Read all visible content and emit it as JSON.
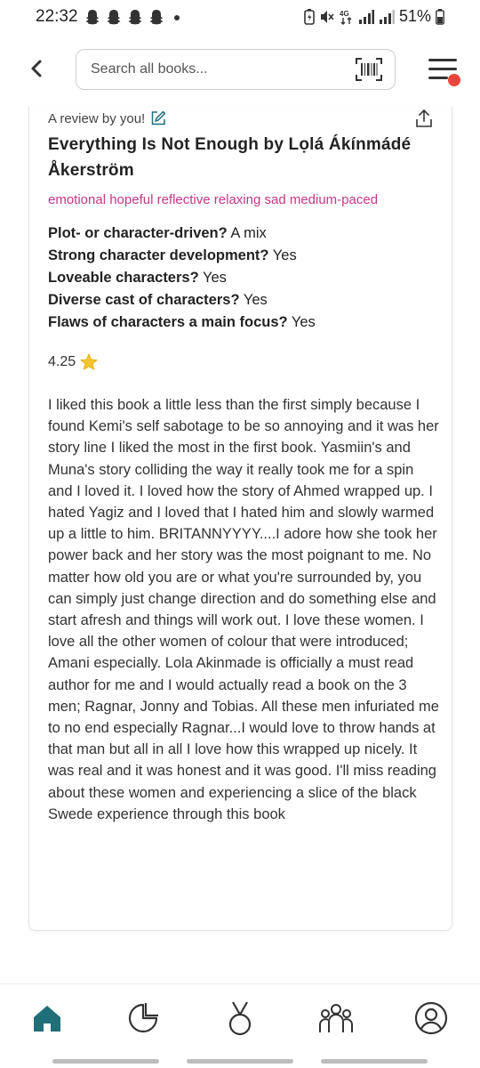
{
  "status_bar": {
    "time": "22:32",
    "battery_percent": "51%",
    "signal_label": "4G",
    "notification_icons": [
      "snapchat-icon",
      "snapchat-icon",
      "snapchat-icon",
      "snapchat-icon"
    ]
  },
  "header": {
    "search_placeholder": "Search all books...",
    "menu_has_notification": true
  },
  "review": {
    "byline": "A review by you!",
    "title": "Everything Is Not Enough by Lọlá Ákínmádé Åkerström",
    "moods": "emotional hopeful reflective relaxing sad medium-paced",
    "qa": [
      {
        "q": "Plot- or character-driven?",
        "a": "A mix"
      },
      {
        "q": "Strong character development?",
        "a": "Yes"
      },
      {
        "q": "Loveable characters?",
        "a": "Yes"
      },
      {
        "q": "Diverse cast of characters?",
        "a": "Yes"
      },
      {
        "q": "Flaws of characters a main focus?",
        "a": "Yes"
      }
    ],
    "rating": "4.25",
    "text": "I liked this book a little less than the first simply because I found Kemi's self sabotage to be so annoying and it was her story line I liked the most in the first book. Yasmiin's and Muna's story colliding the way it really took me for a spin and I loved it. I loved how the story of Ahmed wrapped up. I hated Yagiz and I loved that I hated him and slowly warmed up a little to him. BRITANNYYYY....I adore how she took her power back and her story was the most poignant to me. No matter how old you are or what you're surrounded by, you can simply just change direction and do something else and start afresh and things will work out. I love these women. I love all the other women of colour that were introduced; Amani especially. Lola Akinmade is officially a must read author for me and I would actually read a book on the 3 men; Ragnar, Jonny and Tobias. All these men infuriated me to no end especially Ragnar...I would love to throw hands at that man but all in all I love how this wrapped up nicely. It was real and it was honest and it was good. I'll miss reading about these women and experiencing a slice of the black Swede experience through this book"
  },
  "nav": {
    "items": [
      "home-icon",
      "stats-icon",
      "challenges-icon",
      "community-icon",
      "profile-icon"
    ],
    "active": "home-icon"
  },
  "colors": {
    "accent": "#1f6f78",
    "mood_pink": "#c2388a",
    "badge_red": "#e8453c",
    "star": "#f4c430"
  }
}
